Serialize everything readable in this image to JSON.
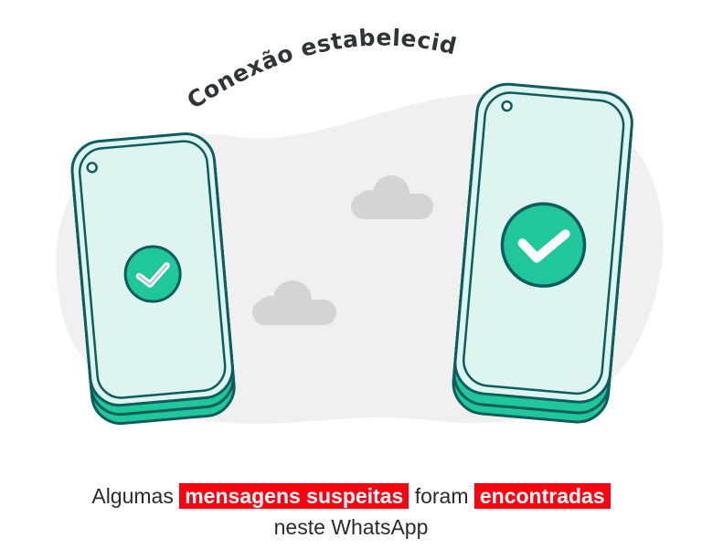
{
  "heading": "Conexão estabelecida",
  "message": {
    "part1": "Algumas",
    "highlight1": "mensagens suspeitas",
    "part2": "foram",
    "highlight2": "encontradas",
    "line2": "neste WhatsApp"
  },
  "icons": {
    "left_status": "check-icon",
    "right_status": "check-icon",
    "clouds": "cloud-icon"
  },
  "colors": {
    "accent_green": "#1fc79a",
    "phone_outline": "#0e5d5e",
    "phone_fill": "#ddf4ef",
    "blob_grey": "#f0f0f0",
    "cloud_grey": "#d4d4d4",
    "highlight_red": "#ff0010"
  }
}
